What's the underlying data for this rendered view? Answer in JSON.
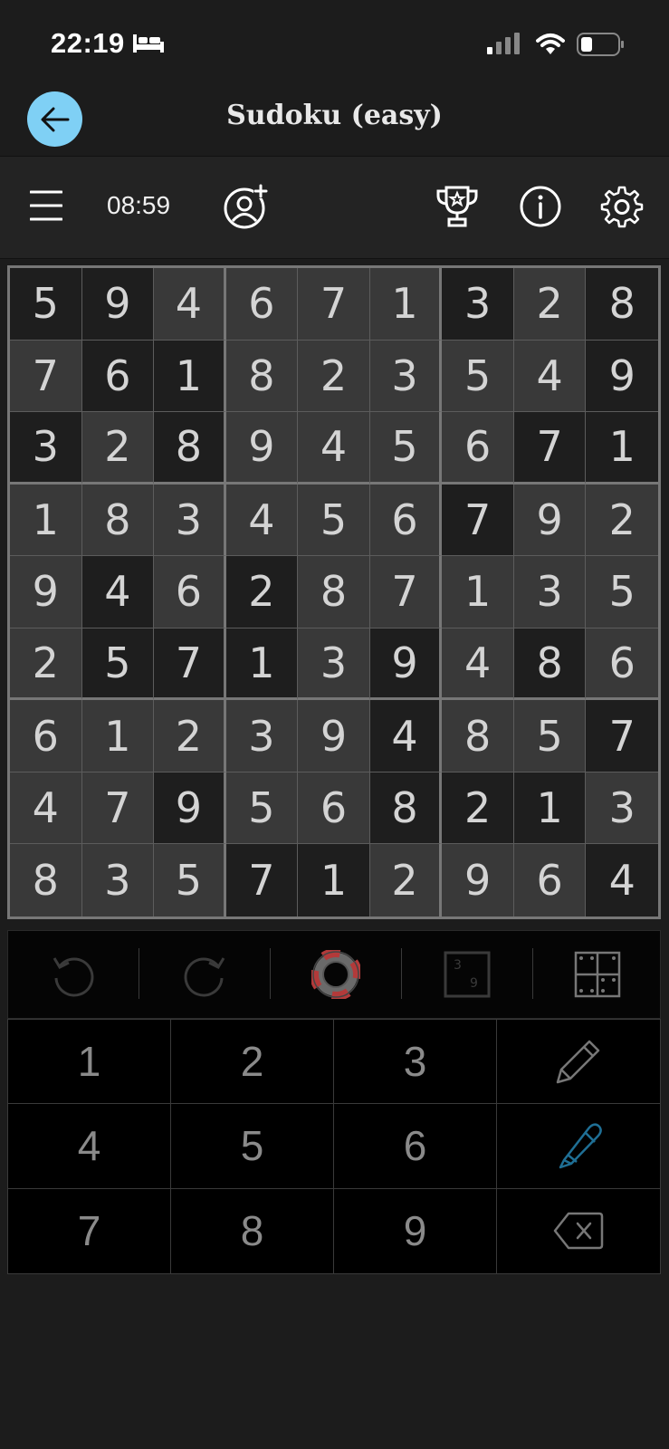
{
  "status": {
    "time": "22:19"
  },
  "header": {
    "title": "Sudoku (easy)"
  },
  "toolbar": {
    "timer": "08:59"
  },
  "grid": {
    "rows": [
      [
        "5",
        "9",
        "4",
        "6",
        "7",
        "1",
        "3",
        "2",
        "8"
      ],
      [
        "7",
        "6",
        "1",
        "8",
        "2",
        "3",
        "5",
        "4",
        "9"
      ],
      [
        "3",
        "2",
        "8",
        "9",
        "4",
        "5",
        "6",
        "7",
        "1"
      ],
      [
        "1",
        "8",
        "3",
        "4",
        "5",
        "6",
        "7",
        "9",
        "2"
      ],
      [
        "9",
        "4",
        "6",
        "2",
        "8",
        "7",
        "1",
        "3",
        "5"
      ],
      [
        "2",
        "5",
        "7",
        "1",
        "3",
        "9",
        "4",
        "8",
        "6"
      ],
      [
        "6",
        "1",
        "2",
        "3",
        "9",
        "4",
        "8",
        "5",
        "7"
      ],
      [
        "4",
        "7",
        "9",
        "5",
        "6",
        "8",
        "2",
        "1",
        "3"
      ],
      [
        "8",
        "3",
        "5",
        "7",
        "1",
        "2",
        "9",
        "6",
        "4"
      ]
    ],
    "shading": [
      [
        "d",
        "d",
        "l",
        "l",
        "l",
        "l",
        "d",
        "l",
        "d"
      ],
      [
        "l",
        "d",
        "d",
        "l",
        "l",
        "l",
        "l",
        "l",
        "d"
      ],
      [
        "d",
        "l",
        "d",
        "l",
        "l",
        "l",
        "l",
        "d",
        "d"
      ],
      [
        "l",
        "l",
        "l",
        "l",
        "l",
        "l",
        "d",
        "l",
        "l"
      ],
      [
        "l",
        "d",
        "l",
        "d",
        "l",
        "l",
        "l",
        "l",
        "l"
      ],
      [
        "l",
        "d",
        "d",
        "d",
        "l",
        "d",
        "l",
        "d",
        "l"
      ],
      [
        "l",
        "l",
        "l",
        "l",
        "l",
        "d",
        "l",
        "l",
        "d"
      ],
      [
        "l",
        "l",
        "d",
        "l",
        "l",
        "d",
        "d",
        "d",
        "l"
      ],
      [
        "l",
        "l",
        "l",
        "d",
        "d",
        "l",
        "l",
        "l",
        "d"
      ]
    ]
  },
  "keypad": {
    "digits": [
      "1",
      "2",
      "3",
      "4",
      "5",
      "6",
      "7",
      "8",
      "9"
    ]
  },
  "icons": {
    "back": "arrow-left-icon",
    "menu": "hamburger-menu-icon",
    "add_player": "add-user-icon",
    "trophy": "trophy-icon",
    "info": "info-icon",
    "settings": "gear-icon",
    "undo": "undo-icon",
    "redo": "redo-icon",
    "hint": "lifebuoy-icon",
    "candidates": "candidates-icon",
    "grid_view": "grid-icon",
    "pencil": "pencil-icon",
    "pen": "pen-icon",
    "erase": "backspace-icon"
  },
  "colors": {
    "accent": "#7fd0f5",
    "pen_active": "#1f6f95",
    "lifebuoy": "#b33a3a"
  }
}
